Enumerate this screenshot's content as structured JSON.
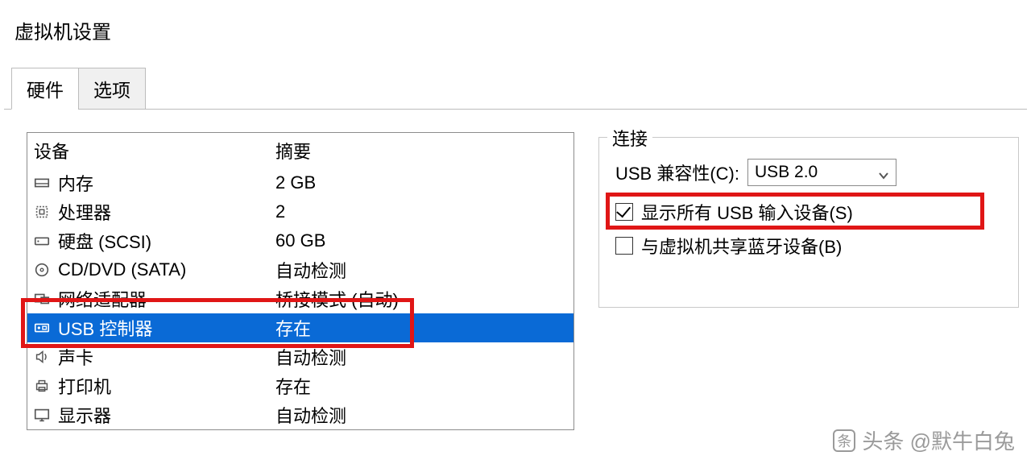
{
  "window": {
    "title": "虚拟机设置"
  },
  "tabs": {
    "hardware": "硬件",
    "options": "选项"
  },
  "list": {
    "header_device": "设备",
    "header_summary": "摘要",
    "rows": [
      {
        "icon": "memory-icon",
        "name": "内存",
        "summary": "2 GB",
        "selected": false
      },
      {
        "icon": "cpu-icon",
        "name": "处理器",
        "summary": "2",
        "selected": false
      },
      {
        "icon": "hdd-icon",
        "name": "硬盘 (SCSI)",
        "summary": "60 GB",
        "selected": false
      },
      {
        "icon": "disc-icon",
        "name": "CD/DVD (SATA)",
        "summary": "自动检测",
        "selected": false
      },
      {
        "icon": "network-icon",
        "name": "网络适配器",
        "summary": "桥接模式 (自动)",
        "selected": false
      },
      {
        "icon": "usb-icon",
        "name": "USB 控制器",
        "summary": "存在",
        "selected": true
      },
      {
        "icon": "sound-icon",
        "name": "声卡",
        "summary": "自动检测",
        "selected": false
      },
      {
        "icon": "printer-icon",
        "name": "打印机",
        "summary": "存在",
        "selected": false
      },
      {
        "icon": "display-icon",
        "name": "显示器",
        "summary": "自动检测",
        "selected": false
      }
    ]
  },
  "connection": {
    "group_title": "连接",
    "compat_label": "USB 兼容性(C):",
    "compat_value": "USB 2.0",
    "show_all_label": "显示所有 USB 输入设备(S)",
    "show_all_checked": true,
    "share_bt_label": "与虚拟机共享蓝牙设备(B)",
    "share_bt_checked": false
  },
  "watermark": "头条 @默牛白兔"
}
